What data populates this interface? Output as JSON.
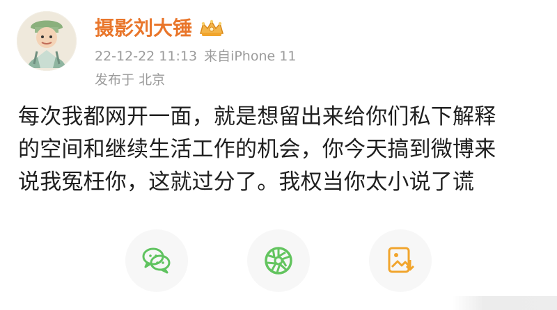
{
  "user": {
    "avatar_icon": "avatar-illustration",
    "name": "摄影刘大锤",
    "badge_icon": "crown-badge-icon"
  },
  "meta": {
    "timestamp": "22-12-22 11:13",
    "source_prefix": "来自",
    "device": "iPhone 11",
    "location_prefix": "发布于",
    "location": "北京"
  },
  "post": {
    "lines": [
      "每次我都网开一面，就是想留出来给你们私下解释",
      "的空间和继续生活工作的机会，你今天搞到微博来",
      "说我冤枉你，这就过分了。我权当你太小说了谎"
    ]
  },
  "actions": [
    {
      "name": "wechat-share",
      "icon": "wechat-icon"
    },
    {
      "name": "moments-share",
      "icon": "moments-icon"
    },
    {
      "name": "save-image",
      "icon": "save-image-icon"
    }
  ],
  "colors": {
    "name": "#e9762b",
    "meta": "#9b9b9b",
    "wechat": "#5fc35f",
    "moments": "#63c45f",
    "save": "#f1a52d"
  }
}
